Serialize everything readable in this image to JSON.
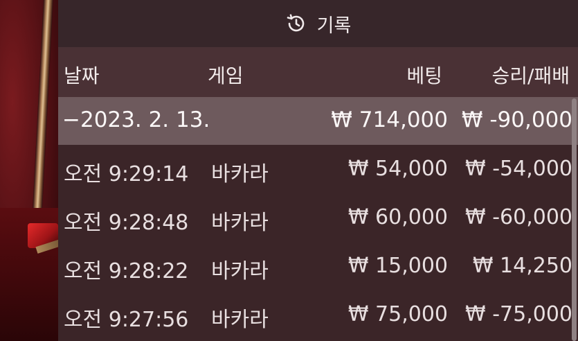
{
  "header": {
    "title": "기록",
    "icon": "history-icon"
  },
  "columns": {
    "date": "날짜",
    "game": "게임",
    "bet": "베팅",
    "win_loss": "승리/패배"
  },
  "date_group": {
    "date": "−2023. 2. 13.",
    "bet": "₩ 714,000",
    "win_loss": "₩ -90,000"
  },
  "rows": [
    {
      "time": "오전 9:29:14",
      "game": "바카라",
      "bet": "₩ 54,000",
      "win_loss": "₩ -54,000"
    },
    {
      "time": "오전 9:28:48",
      "game": "바카라",
      "bet": "₩ 60,000",
      "win_loss": "₩ -60,000"
    },
    {
      "time": "오전 9:28:22",
      "game": "바카라",
      "bet": "₩ 15,000",
      "win_loss": "₩ 14,250"
    },
    {
      "time": "오전 9:27:56",
      "game": "바카라",
      "bet": "₩ 75,000",
      "win_loss": "₩ -75,000"
    }
  ],
  "colors": {
    "panel_bg": "#3b2528",
    "header_bg": "#4a3135",
    "date_row_bg": "#6e5a5d",
    "text": "#e8dfe0"
  }
}
